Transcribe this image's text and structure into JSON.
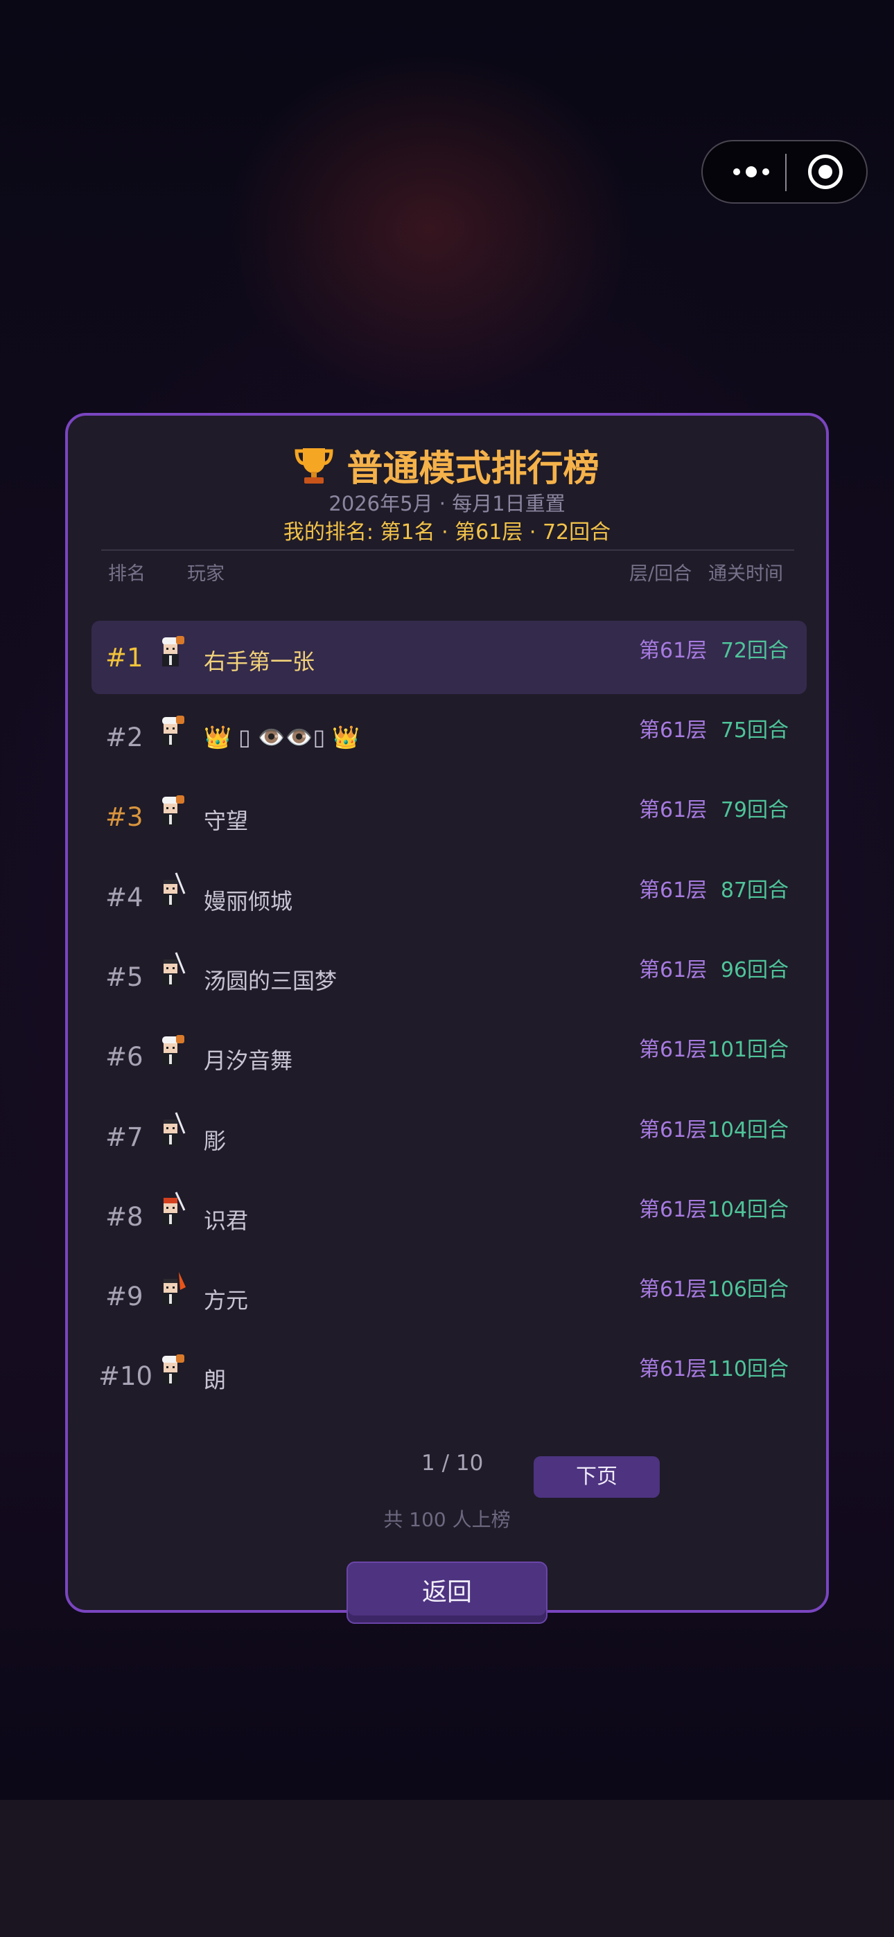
{
  "leaderboard": {
    "title": "普通模式排行榜",
    "subtitle": "2026年5月 · 每月1日重置",
    "my_rank": "我的排名: 第1名 · 第61层 · 72回合",
    "headers": {
      "rank": "排名",
      "player": "玩家",
      "floor": "层/回合",
      "time": "通关时间"
    },
    "rows": [
      {
        "rank": "#1",
        "name": "右手第一张",
        "floor": "第61层",
        "turns": "72回合",
        "avatar": "chef-icon"
      },
      {
        "rank": "#2",
        "name": "👑 ▯  👁‍👁▯   👑",
        "floor": "第61层",
        "turns": "75回合",
        "avatar": "chef-icon"
      },
      {
        "rank": "#3",
        "name": "守望",
        "floor": "第61层",
        "turns": "79回合",
        "avatar": "chef-icon"
      },
      {
        "rank": "#4",
        "name": "嫚丽倾城",
        "floor": "第61层",
        "turns": "87回合",
        "avatar": "swordsman-icon"
      },
      {
        "rank": "#5",
        "name": "汤圆的三国梦",
        "floor": "第61层",
        "turns": "96回合",
        "avatar": "swordsman-icon"
      },
      {
        "rank": "#6",
        "name": "月汐音舞",
        "floor": "第61层",
        "turns": "101回合",
        "avatar": "chef-icon"
      },
      {
        "rank": "#7",
        "name": "彫",
        "floor": "第61层",
        "turns": "104回合",
        "avatar": "swordsman-icon"
      },
      {
        "rank": "#8",
        "name": "识君",
        "floor": "第61层",
        "turns": "104回合",
        "avatar": "red-swordsman-icon"
      },
      {
        "rank": "#9",
        "name": "方元",
        "floor": "第61层",
        "turns": "106回合",
        "avatar": "fire-swordsman-icon"
      },
      {
        "rank": "#10",
        "name": "朗",
        "floor": "第61层",
        "turns": "110回合",
        "avatar": "chef-icon"
      }
    ],
    "pager": {
      "page": "1 / 10",
      "next_label": "下页"
    },
    "total": "共 100 人上榜",
    "back_label": "返回"
  },
  "capsule": {
    "more_icon": "more-dots-icon",
    "close_icon": "target-icon"
  },
  "colors": {
    "accent": "#7a45c0",
    "gold": "#f5b24a",
    "floor": "#a77be0",
    "turns": "#4fc49a"
  }
}
